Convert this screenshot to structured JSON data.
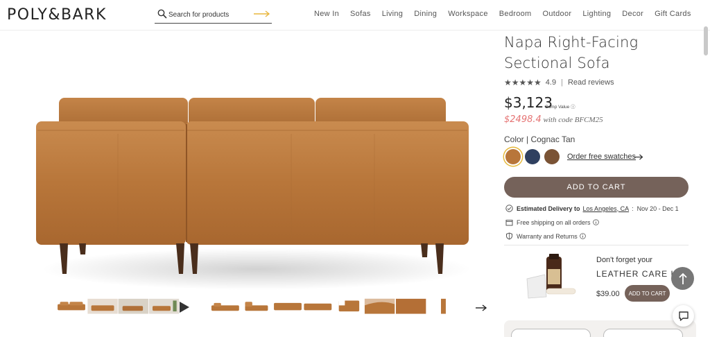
{
  "header": {
    "logo": "POLY&BARK",
    "search": {
      "placeholder": "Search for products"
    },
    "nav": [
      "New In",
      "Sofas",
      "Living",
      "Dining",
      "Workspace",
      "Bedroom",
      "Outdoor",
      "Lighting",
      "Decor",
      "Gift Cards"
    ]
  },
  "product": {
    "title_line1": "Napa Right-Facing",
    "title_line2": "Sectional Sofa",
    "rating": "4.9",
    "read_reviews": "Read reviews",
    "price": "$3,123",
    "comp_value": "Comp Value",
    "promo_price": "$2498.4",
    "promo_text": "with code BFCM25",
    "color_label": "Color | Cognac Tan",
    "swatches": [
      {
        "name": "Cognac Tan",
        "color": "#b8763a"
      },
      {
        "name": "Navy",
        "color": "#2f4060"
      },
      {
        "name": "Brown",
        "color": "#7a5335"
      }
    ],
    "order_swatches": "Order free swatches",
    "add_to_cart": "ADD TO CART",
    "delivery_label": "Estimated Delivery to",
    "delivery_location": "Los Angeles, CA",
    "delivery_dates": "Nov 20 - Dec 1",
    "shipping": "Free shipping on all orders",
    "warranty": "Warranty and Returns"
  },
  "upsell": {
    "pre": "Don't forget your",
    "title": "LEATHER CARE KIT",
    "price": "$39.00",
    "button": "ADD TO CART"
  },
  "colors": {
    "accent": "#75625a",
    "leather": "#b8763a",
    "promo": "#e57373"
  },
  "icons": [
    "search-icon",
    "arrow-right-icon",
    "star-icon",
    "info-icon",
    "check-circle-icon",
    "box-icon",
    "shield-icon",
    "play-icon",
    "arrow-up-icon",
    "chat-icon"
  ]
}
